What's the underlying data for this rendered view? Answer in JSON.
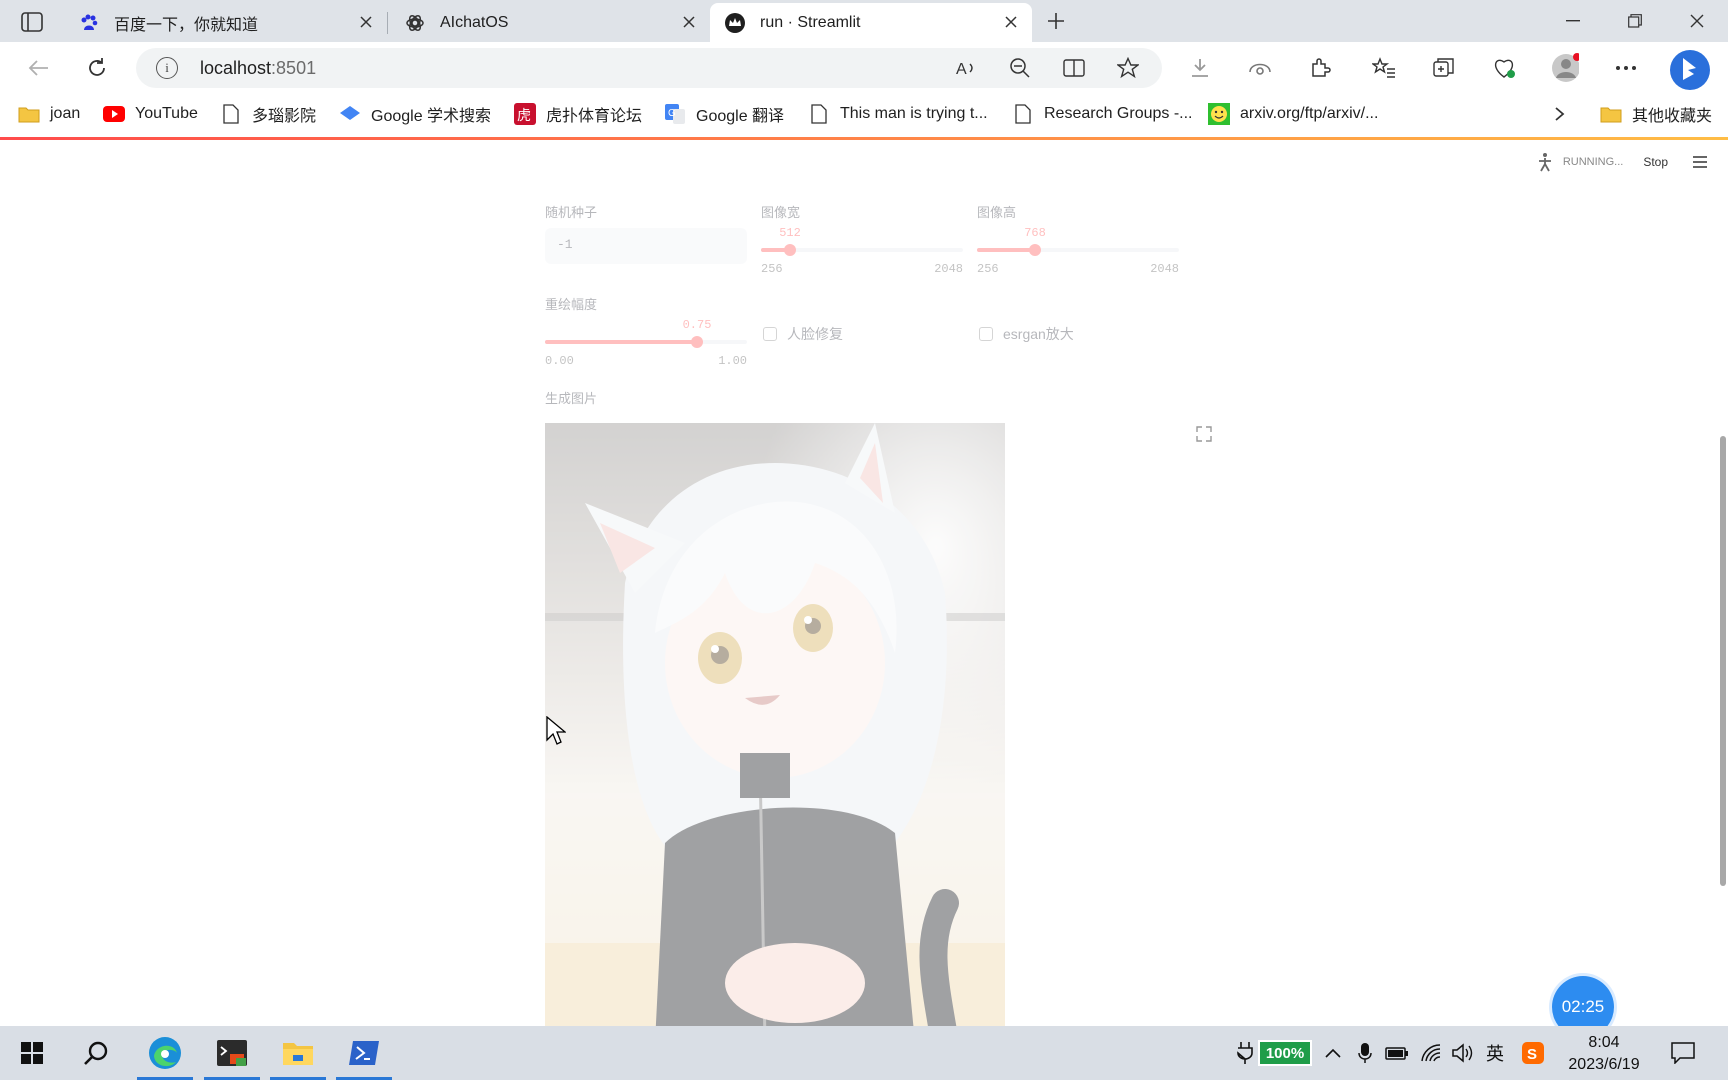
{
  "browser": {
    "tabs": [
      {
        "title": "百度一下，你就知道",
        "icon": "baidu-paw-icon",
        "active": false
      },
      {
        "title": "AIchatOS",
        "icon": "openai-logo-icon",
        "active": false
      },
      {
        "title": "run · Streamlit",
        "icon": "streamlit-crown-icon",
        "active": true
      }
    ],
    "address": {
      "host": "localhost",
      "port": ":8501"
    },
    "bookmarks": [
      {
        "label": "joan",
        "icon": "folder-icon"
      },
      {
        "label": "YouTube",
        "icon": "youtube-icon"
      },
      {
        "label": "多瑙影院",
        "icon": "page-icon"
      },
      {
        "label": "Google 学术搜索",
        "icon": "scholar-icon"
      },
      {
        "label": "虎扑体育论坛",
        "icon": "hupu-icon"
      },
      {
        "label": "Google 翻译",
        "icon": "translate-icon"
      },
      {
        "label": "This man is trying t...",
        "icon": "page-icon"
      },
      {
        "label": "Research Groups -...",
        "icon": "page-icon"
      },
      {
        "label": "arxiv.org/ftp/arxiv/...",
        "icon": "smiley-icon"
      },
      {
        "label": "其他收藏夹",
        "icon": "folder-icon"
      }
    ]
  },
  "app": {
    "status": {
      "running": "RUNNING...",
      "stop": "Stop"
    },
    "seed": {
      "label": "随机种子",
      "value": "-1"
    },
    "width": {
      "label": "图像宽",
      "value": "512",
      "min": "256",
      "max": "2048",
      "fraction": 0.1429
    },
    "height": {
      "label": "图像高",
      "value": "768",
      "min": "256",
      "max": "2048",
      "fraction": 0.2857
    },
    "strength": {
      "label": "重绘幅度",
      "value": "0.75",
      "min": "0.00",
      "max": "1.00",
      "fraction": 0.75
    },
    "face_restore": {
      "label": "人脸修复",
      "checked": false
    },
    "esrgan": {
      "label": "esrgan放大",
      "checked": false
    },
    "output_label": "生成图片",
    "timer": "02:25"
  },
  "taskbar": {
    "battery": "100%",
    "ime": "英",
    "time": "8:04",
    "date": "2023/6/19"
  },
  "colors": {
    "accent": "#ff4b4b",
    "edge_tab_bg": "#dfe3e8",
    "taskbar": "#d9dee5"
  }
}
